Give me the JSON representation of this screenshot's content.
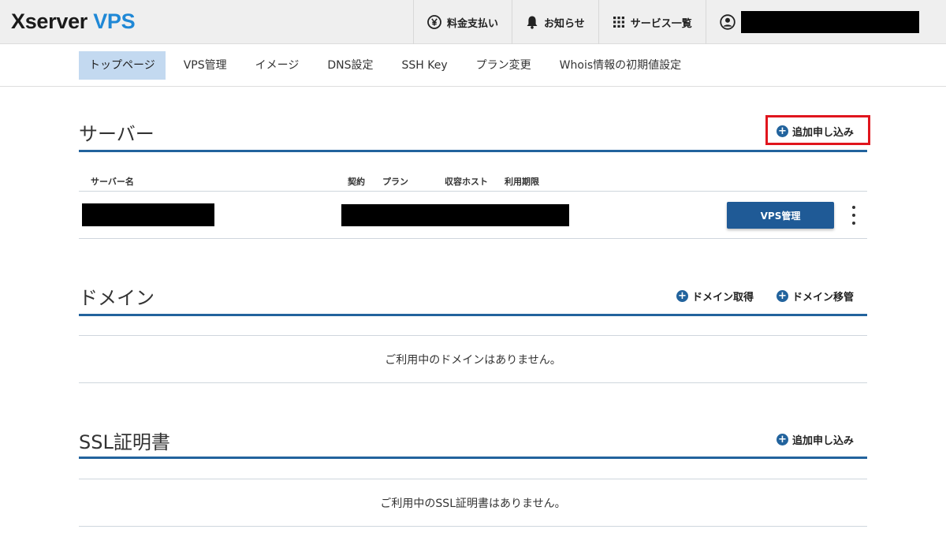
{
  "header": {
    "logo_part1": "Xserver",
    "logo_part2": "VPS",
    "nav": [
      {
        "label": "料金支払い",
        "icon": "yen-circle-icon"
      },
      {
        "label": "お知らせ",
        "icon": "bell-icon"
      },
      {
        "label": "サービス一覧",
        "icon": "grid-icon"
      }
    ],
    "user_icon": "user-circle-icon"
  },
  "subnav": {
    "tabs": [
      "トップページ",
      "VPS管理",
      "イメージ",
      "DNS設定",
      "SSH Key",
      "プラン変更",
      "Whois情報の初期値設定"
    ],
    "active": "トップページ"
  },
  "server": {
    "title": "サーバー",
    "add_label": "追加申し込み",
    "columns": {
      "name": "サーバー名",
      "contract": "契約",
      "plan": "プラン",
      "host": "収容ホスト",
      "expiry": "利用期限"
    },
    "manage_button": "VPS管理"
  },
  "domain": {
    "title": "ドメイン",
    "acquire_label": "ドメイン取得",
    "transfer_label": "ドメイン移管",
    "empty": "ご利用中のドメインはありません。"
  },
  "ssl": {
    "title": "SSL証明書",
    "add_label": "追加申し込み",
    "empty": "ご利用中のSSL証明書はありません。"
  },
  "colors": {
    "accent": "#22639d",
    "button": "#1f5a96",
    "active_tab": "#c3d9f0",
    "highlight": "#e0151d"
  }
}
